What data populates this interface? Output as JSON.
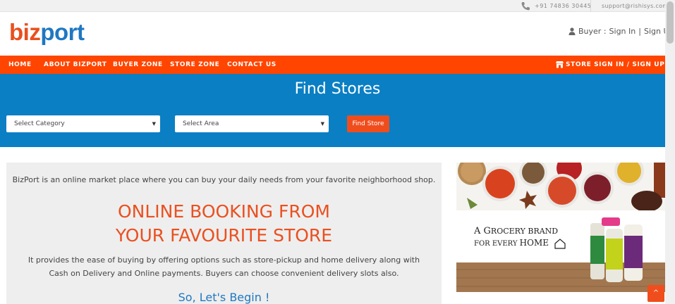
{
  "topbar": {
    "phone": "+91 74836 30445",
    "email": "support@rishisys.com",
    "phone_icon": "phone-icon"
  },
  "header": {
    "logo_part1": "biz",
    "logo_part2": "port",
    "buyer_prefix": "Buyer : ",
    "sign_in": "Sign In",
    "divider": " | ",
    "sign_up": "Sign Up",
    "user_icon": "user-icon"
  },
  "nav": {
    "items": [
      "HOME",
      "ABOUT BIZPORT",
      "BUYER ZONE",
      "STORE ZONE",
      "CONTACT US"
    ],
    "store_signin": "STORE SIGN IN / SIGN UP",
    "store_icon": "store-icon"
  },
  "search": {
    "title": "Find Stores",
    "category_placeholder": "Select Category",
    "area_placeholder": "Select Area",
    "button": "Find Store"
  },
  "content": {
    "intro": "BizPort is an online market place where you can buy your daily needs from your favorite neighborhood shop.",
    "headline_line1": "ONLINE BOOKING FROM",
    "headline_line2": "YOUR FAVOURITE STORE",
    "description": "It provides the ease of buying by offering options such as store-pickup and home delivery along with Cash on Delivery and Online payments. Buyers can choose convenient delivery slots also.",
    "cta": "So, Let's Begin !"
  },
  "ad": {
    "tagline_a": "A G",
    "tagline_b": "ROCERY BRAND",
    "tagline_c": "FOR EVERY ",
    "tagline_d": "HOME"
  },
  "back_to_top": "^",
  "colors": {
    "accent_orange": "#ff4500",
    "brand_blue": "#0a7fc4",
    "logo_blue": "#1f78c1",
    "logo_orange": "#e8501e"
  }
}
